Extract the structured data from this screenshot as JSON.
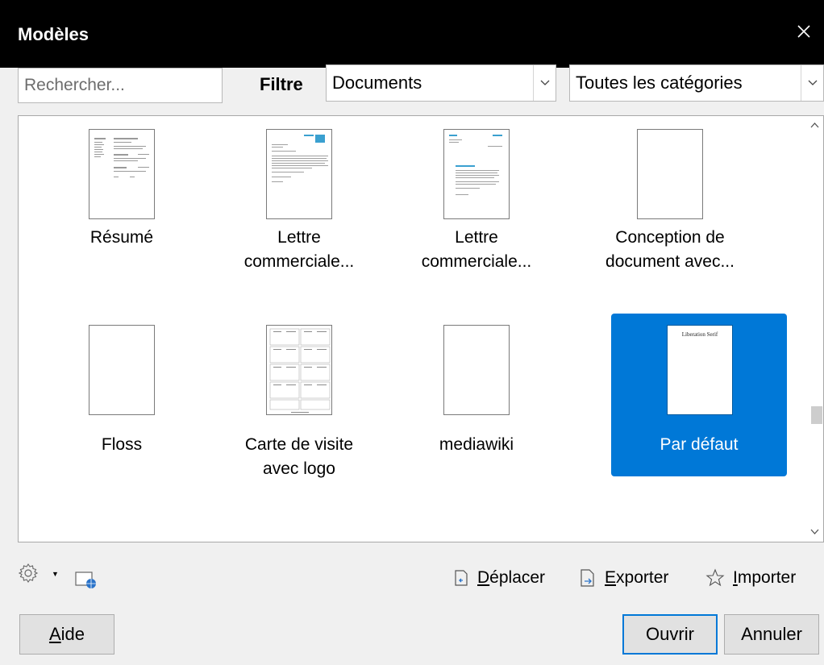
{
  "window": {
    "title": "Modèles",
    "close_icon": "close-icon"
  },
  "search": {
    "placeholder": "Rechercher..."
  },
  "filter": {
    "label": "Filtre",
    "type_value": "Documents",
    "category_value": "Toutes les catégories"
  },
  "templates": [
    {
      "label": "Résumé"
    },
    {
      "label": "Lettre commerciale..."
    },
    {
      "label": "Lettre commerciale..."
    },
    {
      "label": "Conception de document avec..."
    },
    {
      "label": "Floss"
    },
    {
      "label": "Carte de visite avec logo"
    },
    {
      "label": "mediawiki"
    },
    {
      "label": "Par défaut",
      "selected": true,
      "thumb_text": "Liberation Serif"
    }
  ],
  "actions": {
    "move": {
      "accel": "D",
      "rest": "éplacer"
    },
    "export": {
      "accel": "E",
      "rest": "xporter"
    },
    "import": {
      "accel": "I",
      "rest": "mporter"
    }
  },
  "buttons": {
    "help": {
      "accel": "A",
      "rest": "ide"
    },
    "open": "Ouvrir",
    "cancel": "Annuler"
  },
  "colors": {
    "selection": "#0078d7",
    "titlebar": "#000000"
  }
}
